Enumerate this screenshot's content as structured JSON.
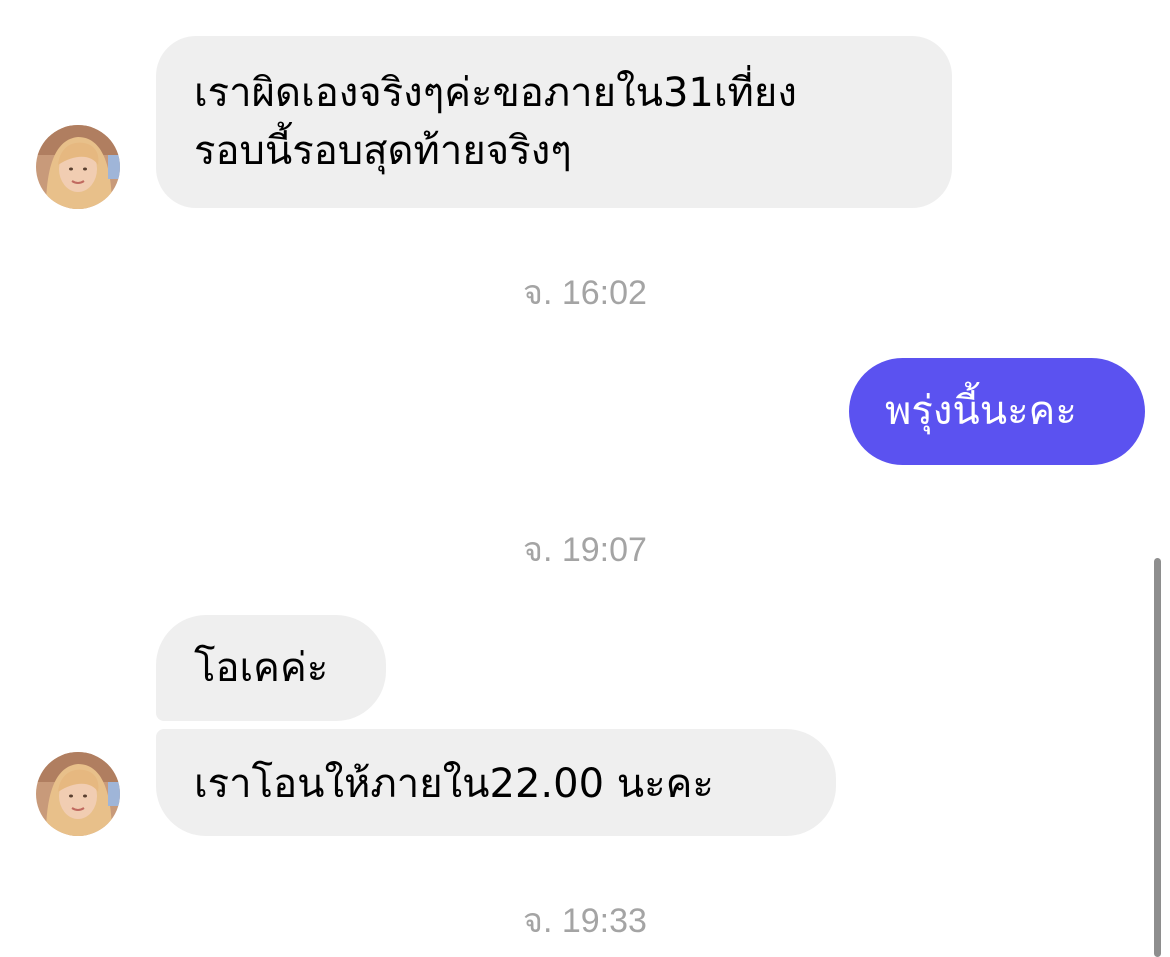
{
  "conversation": {
    "messages": [
      {
        "direction": "incoming",
        "lines": [
          "เราผิดเองจริงๆค่ะขอภายใน31เที่ยง",
          "รอบนี้รอบสุดท้ายจริงๆ"
        ]
      },
      {
        "direction": "outgoing",
        "text": "พรุ่งนี้นะคะ"
      },
      {
        "direction": "incoming",
        "text": "โอเคค่ะ"
      },
      {
        "direction": "incoming",
        "text": "เราโอนให้ภายใน22.00 นะคะ"
      }
    ],
    "timestamps": [
      "จ. 16:02",
      "จ. 19:07",
      "จ. 19:33"
    ]
  },
  "icons": {
    "avatar": "contact-avatar-photo"
  },
  "colors": {
    "incoming_bubble": "#efefef",
    "outgoing_bubble": "#5b52f0",
    "timestamp_text": "#a4a4a4"
  }
}
